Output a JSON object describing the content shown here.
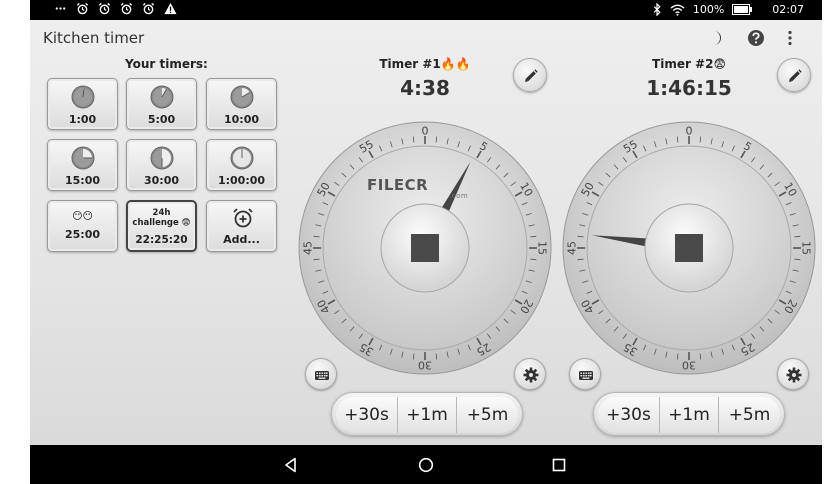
{
  "status_bar": {
    "left_icons": [
      "more-icon",
      "alarm-icon",
      "alarm-icon",
      "alarm-icon",
      "alarm-icon",
      "warning-icon"
    ],
    "battery": "100%",
    "clock": "02:07"
  },
  "app": {
    "title": "Kitchen timer",
    "toolbar_icons": [
      "night-mode-icon",
      "help-icon",
      "overflow-menu-icon"
    ]
  },
  "presets": {
    "heading": "Your timers:",
    "items": [
      {
        "label": "1:00",
        "minutes": 1
      },
      {
        "label": "5:00",
        "minutes": 5
      },
      {
        "label": "10:00",
        "minutes": 10
      },
      {
        "label": "15:00",
        "minutes": 15
      },
      {
        "label": "30:00",
        "minutes": 30
      },
      {
        "label": "1:00:00",
        "minutes": 60
      },
      {
        "label": "25:00",
        "emoji": "😶😶"
      },
      {
        "label": "22:25:20",
        "title": "24h challenge 😨"
      },
      {
        "label": "Add..."
      }
    ]
  },
  "timers": [
    {
      "title": "Timer #1🔥🔥",
      "time": "4:38",
      "pointer_minutes": 4.63,
      "add_buttons": [
        "+30s",
        "+1m",
        "+5m"
      ]
    },
    {
      "title": "Timer #2😨",
      "time": "1:46:15",
      "pointer_minutes": 46.25,
      "add_buttons": [
        "+30s",
        "+1m",
        "+5m"
      ]
    }
  ],
  "dial_labels": [
    "0",
    "5",
    "10",
    "15",
    "20",
    "25",
    "30",
    "35",
    "40",
    "45",
    "50",
    "55"
  ],
  "watermark": {
    "text": "FILECR",
    "sub": ".com"
  },
  "nav": [
    "back-icon",
    "home-icon",
    "recents-icon"
  ],
  "colors": {
    "accent_fire": "#f4511e",
    "pointer": "#444444"
  }
}
